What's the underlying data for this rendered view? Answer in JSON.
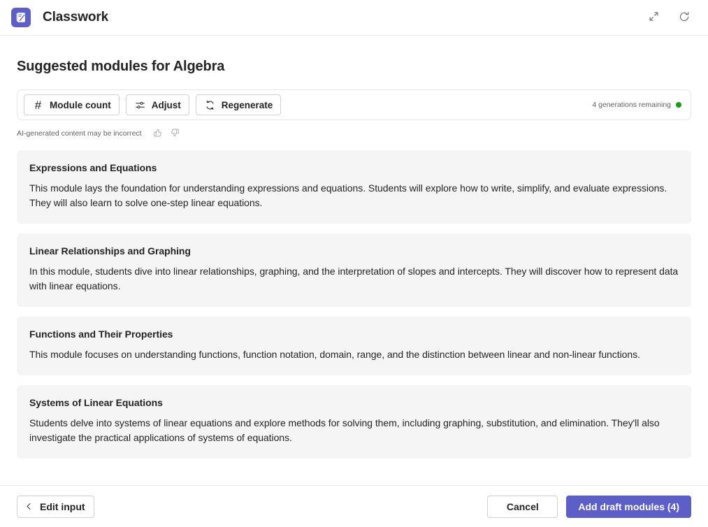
{
  "header": {
    "app_title": "Classwork",
    "logo_icon": "classwork-notebook-icon",
    "logo_color": "#5b5fc7",
    "actions": [
      {
        "icon": "expand-diagonal-icon",
        "name": "expand-button"
      },
      {
        "icon": "refresh-icon",
        "name": "refresh-button"
      }
    ]
  },
  "main": {
    "page_title": "Suggested modules for Algebra",
    "toolbar": {
      "buttons": [
        {
          "label": "Module count",
          "icon": "hash-icon"
        },
        {
          "label": "Adjust",
          "icon": "sliders-icon"
        },
        {
          "label": "Regenerate",
          "icon": "refresh-circle-icon"
        }
      ],
      "status": {
        "text": "4 generations remaining",
        "dot_color": "#13a10e",
        "dot_icon": "status-dot-icon"
      }
    },
    "disclaimer": {
      "text": "AI-generated content may be incorrect",
      "thumbs_up_icon": "thumbs-up-icon",
      "thumbs_down_icon": "thumbs-down-icon"
    },
    "modules": [
      {
        "title": "Expressions and Equations",
        "description": "This module lays the foundation for understanding expressions and equations. Students will explore how to write, simplify, and evaluate expressions. They will also learn to solve one-step linear equations."
      },
      {
        "title": "Linear Relationships and Graphing",
        "description": "In this module, students dive into linear relationships, graphing, and the interpretation of slopes and intercepts. They will discover how to represent data with linear equations."
      },
      {
        "title": "Functions and Their Properties",
        "description": "This module focuses on understanding functions, function notation, domain, range, and the distinction between linear and non-linear functions."
      },
      {
        "title": "Systems of Linear Equations",
        "description": "Students delve into systems of linear equations and explore methods for solving them, including graphing, substitution, and elimination. They'll also investigate the practical applications of systems of equations."
      }
    ]
  },
  "footer": {
    "edit_input_label": "Edit input",
    "edit_input_icon": "chevron-left-icon",
    "cancel_label": "Cancel",
    "add_modules_label": "Add draft modules (4)",
    "primary_color": "#5b5fc7"
  }
}
